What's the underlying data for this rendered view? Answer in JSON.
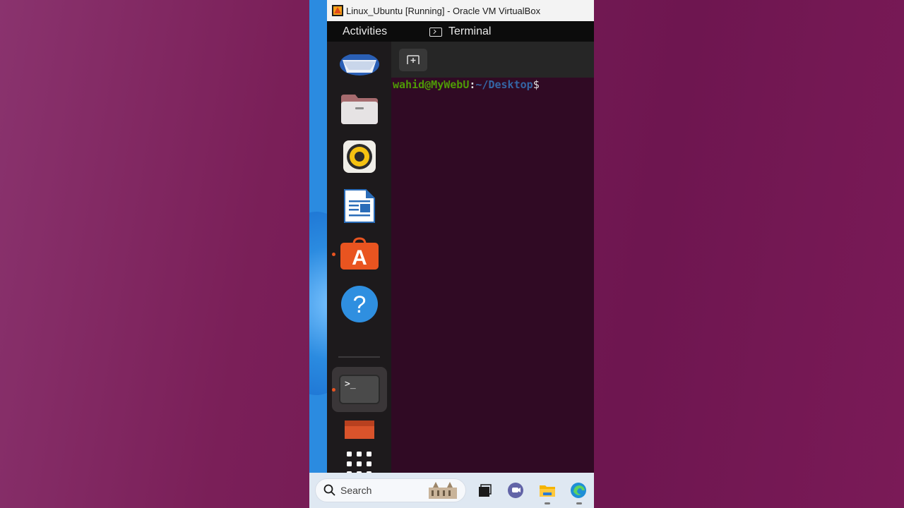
{
  "vbox": {
    "title": "Linux_Ubuntu [Running] - Oracle VM VirtualBox"
  },
  "topbar": {
    "activities": "Activities",
    "app_name": "Terminal"
  },
  "dock": {
    "items": [
      {
        "name": "thunderbird-icon",
        "running": false
      },
      {
        "name": "files-icon",
        "running": false
      },
      {
        "name": "rhythmbox-icon",
        "running": false
      },
      {
        "name": "libreoffice-writer-icon",
        "running": false
      },
      {
        "name": "ubuntu-software-icon",
        "running": true
      },
      {
        "name": "help-icon",
        "running": false
      },
      {
        "name": "terminal-icon",
        "running": true,
        "active": true
      },
      {
        "name": "app-icon",
        "running": false
      },
      {
        "name": "show-apps-icon",
        "running": false
      }
    ],
    "terminal_glyph": ">_",
    "help_glyph": "?",
    "software_glyph": "A"
  },
  "terminal": {
    "prompt_user": "wahid@MyWebU",
    "prompt_colon": ":",
    "prompt_path": "~/Desktop",
    "prompt_dollar": "$"
  },
  "taskbar": {
    "search_placeholder": "Search"
  },
  "colors": {
    "ubuntu_orange": "#e95420",
    "terminal_bg": "#300a24",
    "prompt_green": "#4e9a06",
    "prompt_blue": "#3465a4"
  }
}
